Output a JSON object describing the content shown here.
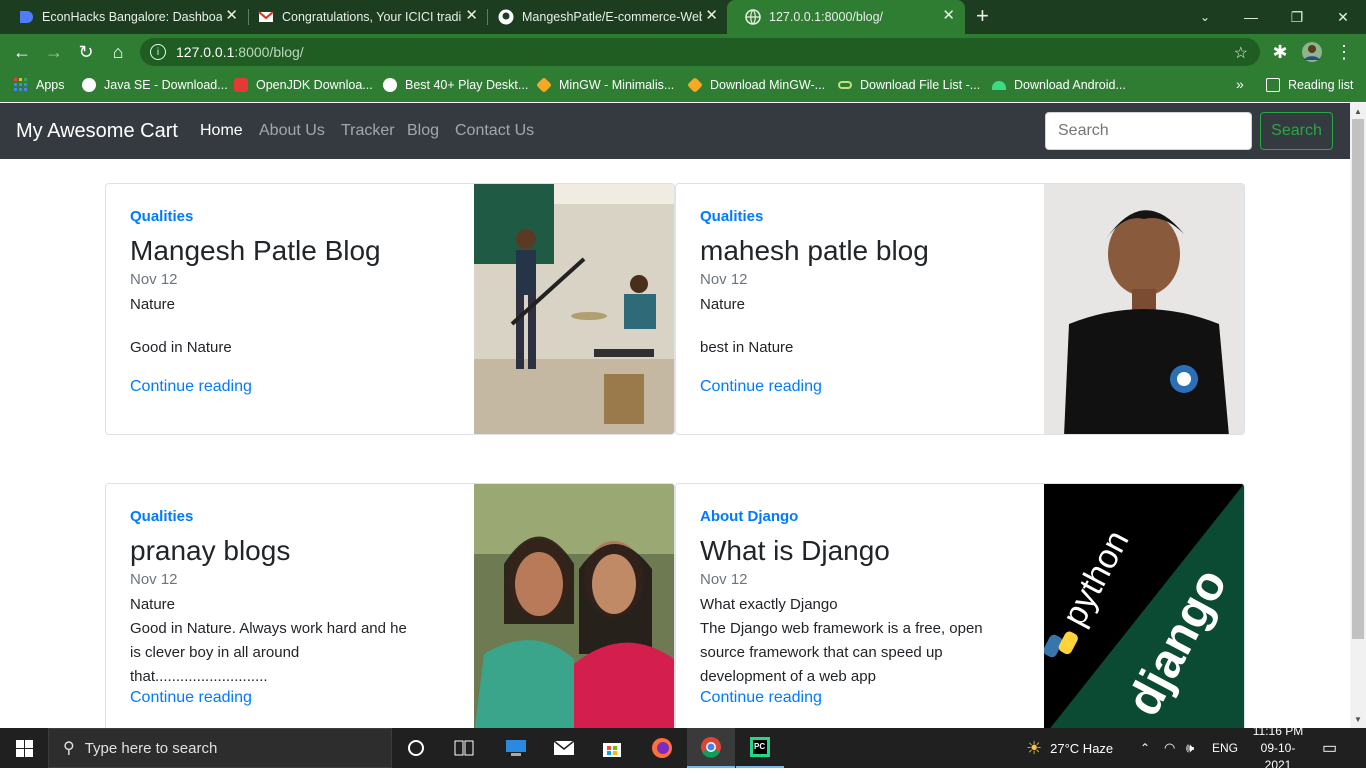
{
  "browser": {
    "tabs": [
      {
        "title": "EconHacks Bangalore: Dashboard",
        "active": false
      },
      {
        "title": "Congratulations, Your ICICI trading",
        "active": false
      },
      {
        "title": "MangeshPatle/E-commerce-Web",
        "active": false
      },
      {
        "title": "127.0.0.1:8000/blog/",
        "active": true
      }
    ],
    "url_host": "127.0.0.1",
    "url_path": ":8000/blog/",
    "bookmarks": [
      {
        "label": "Apps",
        "icon": "apps-grid-icon"
      },
      {
        "label": "Java SE - Download...",
        "icon": "globe-icon"
      },
      {
        "label": "OpenJDK Downloa...",
        "icon": "openjdk-icon"
      },
      {
        "label": "Best 40+ Play Deskt...",
        "icon": "globe-icon"
      },
      {
        "label": "MinGW - Minimalis...",
        "icon": "mingw-icon"
      },
      {
        "label": "Download MinGW-...",
        "icon": "mingw-icon"
      },
      {
        "label": "Download File List -...",
        "icon": "link-icon"
      },
      {
        "label": "Download Android...",
        "icon": "android-icon"
      }
    ],
    "bookmarks_more": "»",
    "reading_list": "Reading list"
  },
  "navbar": {
    "brand": "My Awesome Cart",
    "links": [
      "Home",
      "About Us",
      "Tracker",
      "Blog",
      "Contact Us"
    ],
    "active_link": "Home",
    "search_placeholder": "Search",
    "search_button": "Search"
  },
  "posts": [
    {
      "category": "Qualities",
      "title": "Mangesh Patle Blog",
      "date": "Nov 12",
      "line1": "Nature",
      "line2": "Good in Nature",
      "read_more": "Continue reading"
    },
    {
      "category": "Qualities",
      "title": "mahesh patle blog",
      "date": "Nov 12",
      "line1": "Nature",
      "line2": "best in Nature",
      "read_more": "Continue reading"
    },
    {
      "category": "Qualities",
      "title": "pranay blogs",
      "date": "Nov 12",
      "line1": "Nature",
      "line2": "Good in Nature. Always work hard and he is clever boy in all around that...........................",
      "read_more": "Continue reading"
    },
    {
      "category": "About Django",
      "title": "What is Django",
      "date": "Nov 12",
      "line1": "What exactly Django",
      "line2": "The Django web framework is a free, open source framework that can speed up development of a web app",
      "read_more": "Continue reading"
    }
  ],
  "taskbar": {
    "search_placeholder": "Type here to search",
    "weather": "27°C  Haze",
    "language": "ENG",
    "time": "11:16 PM",
    "date": "09-10-2021"
  },
  "colors": {
    "tab_bar": "#1c3d1f",
    "toolbar": "#2e7d32",
    "navbar": "#343a40",
    "link": "#007bff",
    "success": "#28a745"
  }
}
